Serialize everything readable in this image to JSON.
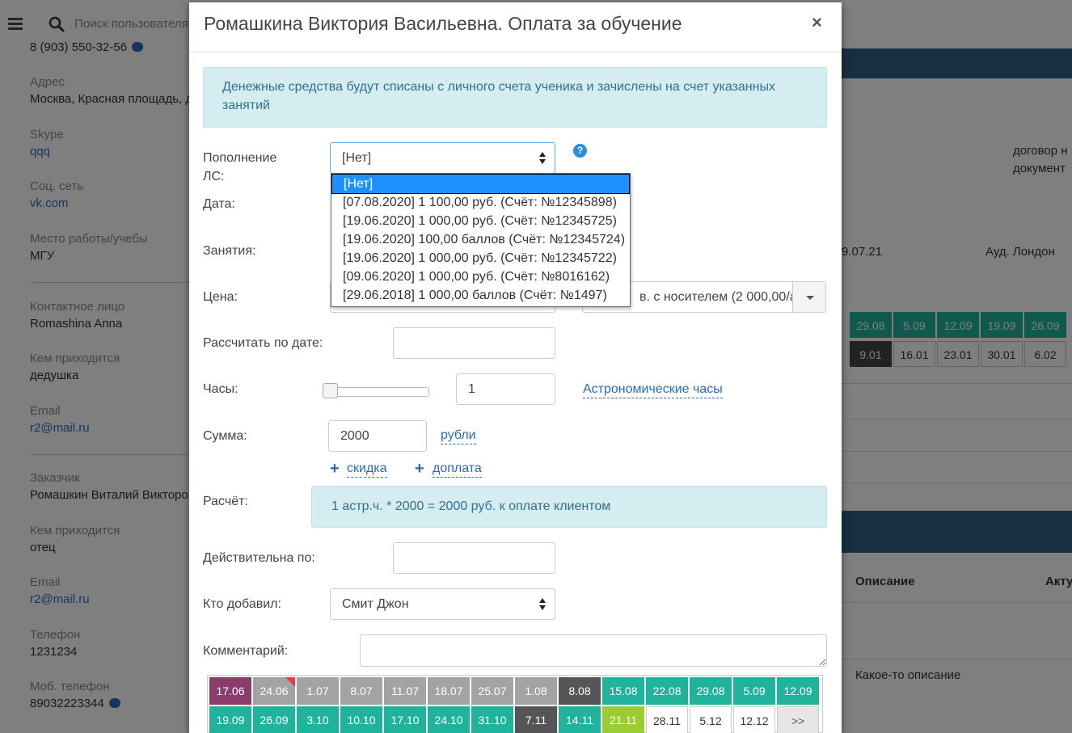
{
  "background": {
    "search_placeholder": "Поиск пользователя",
    "phone_partial": "8 (903) 550-32-56",
    "fields": [
      {
        "label": "Адрес",
        "value": "Москва, Красная площадь, д"
      },
      {
        "label": "Skype",
        "value": "qqq"
      },
      {
        "label": "Соц. сеть",
        "value": "vk.com"
      },
      {
        "label": "Место работы/учебы",
        "value": "МГУ"
      },
      {
        "label": "Контактное лицо",
        "value": "Romashina Anna"
      },
      {
        "label": "Кем приходится",
        "value": "дедушка"
      },
      {
        "label": "Email",
        "value": "r2@mail.ru"
      },
      {
        "label": "Заказчик",
        "value": "Ромашкин Виталий Викторо"
      },
      {
        "label": "Кем приходится",
        "value": "отец"
      },
      {
        "label": "Email",
        "value": "r2@mail.ru"
      },
      {
        "label": "Телефон",
        "value": "1231234"
      },
      {
        "label": "Моб. телефон",
        "value": "89032223344"
      }
    ],
    "right": {
      "doc_line1": "договор н",
      "doc_line2": "документ",
      "date": "9.07.21",
      "room": "Ауд. Лондон",
      "row1": [
        "29.08",
        "5.09",
        "12.09",
        "19.09",
        "26.09"
      ],
      "row2": [
        "9.01",
        "16.01",
        "23.01",
        "30.01",
        "6.02"
      ],
      "col_description": "Описание",
      "col_actual": "Акту",
      "description_value": "Какое-то описание"
    }
  },
  "modal": {
    "title": "Ромашкина Виктория Васильевна. Оплата за обучение",
    "close": "×",
    "info": "Денежные средства будут списаны с личного счета ученика и зачислены на счет указанных занятий",
    "fields": {
      "topup_label": "Пополнение ЛС:",
      "topup_value": "[Нет]",
      "help": "?",
      "date_label": "Дата:",
      "lessons_label": "Занятия:",
      "price_label": "Цена:",
      "price_partial": "в. с носителем (2 000,00/а",
      "calc_by_date_label": "Рассчитать по дате:",
      "hours_label": "Часы:",
      "hours_value": "1",
      "astro_hours": "Астрономические часы",
      "sum_label": "Сумма:",
      "sum_value": "2000",
      "currency": "рубли",
      "discount": "скидка",
      "surcharge": "доплата",
      "plus": "+",
      "calc_label": "Расчёт:",
      "calc_value": "1 астр.ч. * 2000 = 2000 руб. к оплате клиентом",
      "valid_until_label": "Действительна по:",
      "added_by_label": "Кто добавил:",
      "added_by_value": "Смит Джон",
      "comment_label": "Комментарий:"
    },
    "dropdown_options": [
      "[Нет]",
      "[07.08.2020] 1 100,00 руб. (Счёт: №12345898)",
      "[19.06.2020] 1 000,00 руб. (Счёт: №12345725)",
      "[19.06.2020] 100,00 баллов (Счёт: №12345724)",
      "[19.06.2020] 1 000,00 руб. (Счёт: №12345722)",
      "[09.06.2020] 1 000,00 руб. (Счёт: №8016162)",
      "[29.06.2018] 1 000,00 баллов (Счёт: №1497)"
    ],
    "date_grid": {
      "row1": [
        {
          "d": "17.06",
          "c": "#8a3d6b"
        },
        {
          "d": "24.06",
          "c": "#a3a3a3"
        },
        {
          "d": "1.07",
          "c": "#a3a3a3"
        },
        {
          "d": "8.07",
          "c": "#a3a3a3"
        },
        {
          "d": "11.07",
          "c": "#a3a3a3"
        },
        {
          "d": "18.07",
          "c": "#a3a3a3"
        },
        {
          "d": "25.07",
          "c": "#a3a3a3"
        },
        {
          "d": "1.08",
          "c": "#a3a3a3"
        },
        {
          "d": "8.08",
          "c": "#555555"
        },
        {
          "d": "15.08",
          "c": "#1fb39c"
        },
        {
          "d": "22.08",
          "c": "#1fb39c"
        },
        {
          "d": "29.08",
          "c": "#1fb39c"
        },
        {
          "d": "5.09",
          "c": "#1fb39c"
        },
        {
          "d": "12.09",
          "c": "#1fb39c"
        }
      ],
      "row2": [
        {
          "d": "19.09",
          "c": "#1fb39c"
        },
        {
          "d": "26.09",
          "c": "#1fb39c"
        },
        {
          "d": "3.10",
          "c": "#1fb39c"
        },
        {
          "d": "10.10",
          "c": "#1fb39c"
        },
        {
          "d": "17.10",
          "c": "#1fb39c"
        },
        {
          "d": "24.10",
          "c": "#1fb39c"
        },
        {
          "d": "31.10",
          "c": "#1fb39c"
        },
        {
          "d": "7.11",
          "c": "#555555"
        },
        {
          "d": "14.11",
          "c": "#1fb39c"
        },
        {
          "d": "21.11",
          "c": "#9acd32"
        },
        {
          "d": "28.11",
          "c": "white"
        },
        {
          "d": "5.12",
          "c": "white"
        },
        {
          "d": "12.12",
          "c": "white"
        },
        {
          "d": ">>",
          "c": "more"
        }
      ]
    }
  }
}
